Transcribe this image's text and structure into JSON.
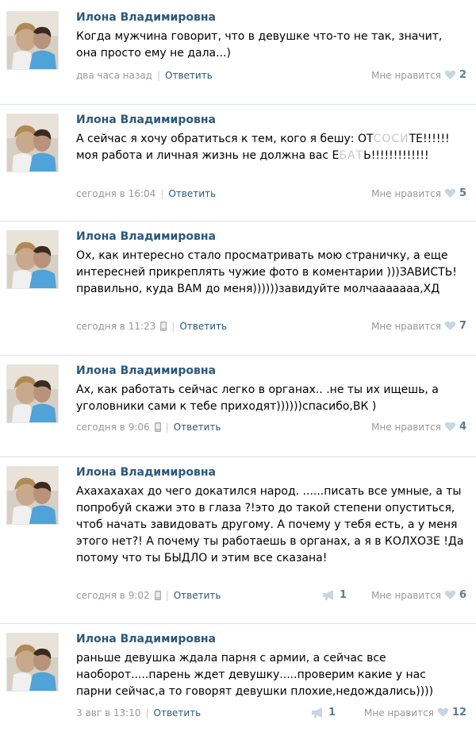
{
  "author_name": "Илона Владимировна",
  "reply_label": "Ответить",
  "like_label": "Мне нравится",
  "colors": {
    "link": "#2b587a",
    "meta": "#999999",
    "count": "#5b7b99",
    "heart": "#c7d6e3"
  },
  "posts": [
    {
      "text": "Когда мужчина говорит, что в девушке что-то не так, значит, она просто ему не дала...)",
      "time": "два часа назад",
      "mobile": false,
      "likes": "2",
      "shares": ""
    },
    {
      "text_pre": "А сейчас я хочу обратиться к тем, кого я бешу: ОТ",
      "text_mask1": "СОСИ",
      "text_mid": "ТЕ!!!!!!моя работа и личная жизнь не должна вас Е",
      "text_mask2": "БАТ",
      "text_post": "Ь!!!!!!!!!!!!!",
      "time": "сегодня в 16:04",
      "mobile": false,
      "likes": "5",
      "shares": ""
    },
    {
      "text": "Ох, как интересно стало просматривать мою страничку, а еще интересней прикреплять чужие фото в коментарии )))ЗАВИСТЬ! правильно, куда ВАМ до меня))))))завидуйте молчааааааа,ХД",
      "time": "сегодня в 11:23",
      "mobile": true,
      "likes": "7",
      "shares": ""
    },
    {
      "text": "Ах, как работать сейчас легко в органах.. .не ты их ищешь, а уголовники сами к тебе приходят))))))спасибо,ВК )",
      "time": "сегодня в 9:06",
      "mobile": true,
      "likes": "4",
      "shares": ""
    },
    {
      "text": "Ахахахахах до чего докатился народ. ......писать все умные, а ты попробуй скажи это в глаза ?!это до такой степени опуститься, чтоб начать завидовать другому. А почему у тебя есть, а у меня этого нет?! А почему ты работаешь в органах, а я в КОЛХОЗЕ !Да потому что ты БЫДЛО и этим все сказана!",
      "time": "сегодня в 9:02",
      "mobile": true,
      "likes": "6",
      "shares": "1"
    },
    {
      "text": "раньше девушка ждала парня с армии, а сейчас все наоборот.....парень ждет девушку.....проверим какие у нас парни сейчас,а то говорят девушки плохие,недождались))))",
      "time": "3 авг в 13:10",
      "mobile": false,
      "likes": "12",
      "shares": "1"
    }
  ]
}
